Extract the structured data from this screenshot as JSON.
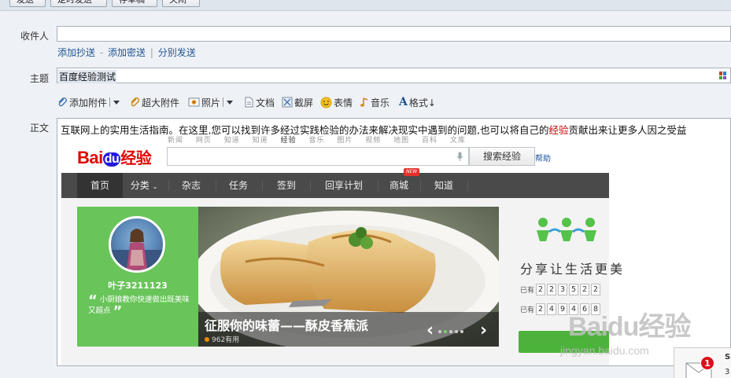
{
  "toolbar": {
    "send": "发送",
    "scheduled_send": "定时发送",
    "save_draft": "存草稿",
    "close": "关闭"
  },
  "recipient": {
    "label": "收件人",
    "value": ""
  },
  "recipient_links": {
    "add_cc": "添加抄送",
    "add_bcc": "添加密送",
    "separate_send": "分别发送",
    "dash": "-",
    "pipe": "|"
  },
  "subject": {
    "label": "主题",
    "value": "百度经验测试"
  },
  "editor_tools": {
    "attach": "添加附件",
    "large_attach": "超大附件",
    "photo": "照片",
    "doc": "文档",
    "screenshot": "截屏",
    "emoji": "表情",
    "music": "音乐",
    "format": "格式↓"
  },
  "body": {
    "label": "正文",
    "text_before": "互联网上的实用生活指南。在这里,您可以找到许多经过实践检验的办法来解决现实中遇到的问题,也可以将自己的",
    "text_highlight": "经验",
    "text_after": "贡献出来让更多人因之受益"
  },
  "embedded": {
    "logo_bai": "Bai",
    "logo_du": "du",
    "logo_jy": "经验",
    "top_links": [
      "新闻",
      "网页",
      "知道",
      "知道",
      "经验",
      "音乐",
      "图片",
      "视频",
      "地图",
      "百科",
      "文库"
    ],
    "search_placeholder": "",
    "search_button": "搜索经验",
    "help": "帮助",
    "nav": [
      "首页",
      "分类",
      "杂志",
      "任务",
      "签到",
      "回享计划",
      "商城",
      "知道"
    ],
    "nav_new_badge": "NEW",
    "profile": {
      "username": "叶子3211123",
      "quote": "小厨娘教你快速做出既美味又超点"
    },
    "banner": {
      "title": "征服你的味蕾——酥皮香蕉派",
      "useful": "962有用"
    },
    "share": {
      "title": "分享让生活更美",
      "row1_label": "已有",
      "row1_digits": [
        "2",
        "2",
        "3",
        "5",
        "2",
        "2"
      ],
      "row2_label": "已有",
      "row2_digits": [
        "2",
        "4",
        "9",
        "4",
        "6",
        "8"
      ]
    }
  },
  "watermark": {
    "text": "Baidu经验",
    "url": "jingyan.baidu.com"
  },
  "notification": {
    "count": "1",
    "side_letter": "S",
    "side_num": "3"
  },
  "colors": {
    "link": "#1e5494",
    "green": "#69c45a",
    "nav_bg": "#4a4a4a",
    "badge_red": "#d8121b",
    "baidu_red": "#e10601",
    "baidu_blue": "#2319dc"
  }
}
